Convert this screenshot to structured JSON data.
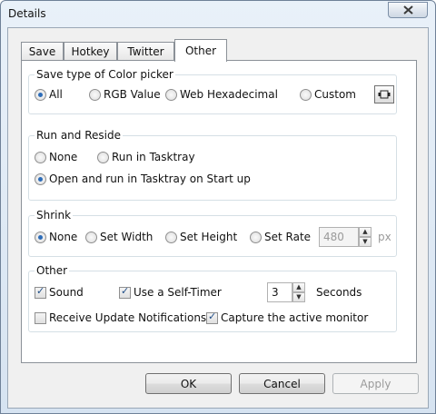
{
  "window": {
    "title": "Details"
  },
  "tabs": [
    {
      "label": "Save"
    },
    {
      "label": "Hotkey"
    },
    {
      "label": "Twitter"
    },
    {
      "label": "Other"
    }
  ],
  "save_type": {
    "title": "Save type of Color picker",
    "options": [
      "All",
      "RGB Value",
      "Web Hexadecimal",
      "Custom"
    ],
    "selected": "All"
  },
  "run_reside": {
    "title": "Run and Reside",
    "options": [
      "None",
      "Run in Tasktray",
      "Open and run in Tasktray on Start up"
    ],
    "selected": "Open and run in Tasktray on Start up"
  },
  "shrink": {
    "title": "Shrink",
    "options": [
      "None",
      "Set Width",
      "Set Height",
      "Set Rate"
    ],
    "selected": "None",
    "value": "480",
    "unit": "px"
  },
  "other": {
    "title": "Other",
    "sound": "Sound",
    "self_timer": "Use a Self-Timer",
    "timer_value": "3",
    "seconds": "Seconds",
    "update": "Receive Update Notifications",
    "capture": "Capture the active monitor"
  },
  "buttons": {
    "ok": "OK",
    "cancel": "Cancel",
    "apply": "Apply"
  }
}
